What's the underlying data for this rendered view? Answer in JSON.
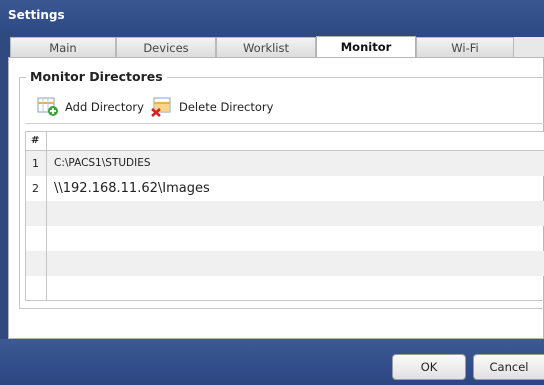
{
  "window": {
    "title": "Settings"
  },
  "tabs": [
    {
      "label": "Main",
      "active": false
    },
    {
      "label": "Devices",
      "active": false
    },
    {
      "label": "Worklist",
      "active": false
    },
    {
      "label": "Monitor",
      "active": true
    },
    {
      "label": "Wi-Fi",
      "active": false
    }
  ],
  "monitor": {
    "section_title": "Monitor Directores",
    "toolbar": {
      "add_label": "Add Directory",
      "delete_label": "Delete Directory"
    },
    "table": {
      "header": "#",
      "rows": [
        {
          "num": "1",
          "path": "C:\\PACS1\\STUDIES"
        },
        {
          "num": "2",
          "path": "\\\\192.168.11.62\\Images"
        }
      ]
    }
  },
  "buttons": {
    "ok": "OK",
    "cancel": "Cancel"
  },
  "colors": {
    "titlebar": "#2e4b84",
    "footer": "#2c4682",
    "panel": "#ffffff"
  }
}
